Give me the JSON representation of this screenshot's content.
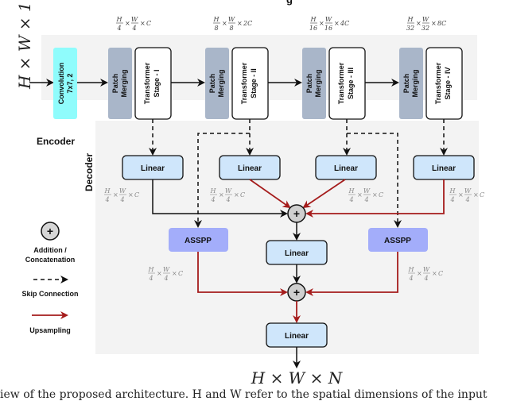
{
  "title_fragment": "g",
  "input_label": "H × W × 1",
  "output_label": "H × W × N",
  "encoder": {
    "label": "Encoder",
    "convolution": {
      "line1": "Convolution",
      "line2": "7x7, 2"
    },
    "stages": [
      {
        "merge": [
          "Patch",
          "Merging"
        ],
        "stage": [
          "Transformer",
          "Stage - I"
        ],
        "dims": {
          "h": "H",
          "hd": "4",
          "w": "W",
          "wd": "4",
          "c": "C"
        }
      },
      {
        "merge": [
          "Patch",
          "Merging"
        ],
        "stage": [
          "Transformer",
          "Stage - II"
        ],
        "dims": {
          "h": "H",
          "hd": "8",
          "w": "W",
          "wd": "8",
          "c": "2C"
        }
      },
      {
        "merge": [
          "Patch",
          "Merging"
        ],
        "stage": [
          "Transformer",
          "Stage - III"
        ],
        "dims": {
          "h": "H",
          "hd": "16",
          "w": "W",
          "wd": "16",
          "c": "4C"
        }
      },
      {
        "merge": [
          "Patch",
          "Merging"
        ],
        "stage": [
          "Transformer",
          "Stage - IV"
        ],
        "dims": {
          "h": "H",
          "hd": "32",
          "w": "W",
          "wd": "32",
          "c": "8C"
        }
      }
    ]
  },
  "decoder": {
    "label": "Decoder",
    "linear_label": "Linear",
    "asspp_label": "ASSPP",
    "dim": {
      "h": "H",
      "hd": "4",
      "w": "W",
      "wd": "4",
      "c": "C"
    },
    "plus": "+"
  },
  "legend": {
    "addition": [
      "Addition /",
      "Concatenation"
    ],
    "skip": "Skip Connection",
    "upsampling": "Upsampling"
  },
  "colors": {
    "conv": "#8ffcfc",
    "merge": "#a9b6c9",
    "linear": "#cfe6fb",
    "asspp": "#a3adfa",
    "upsample": "#a51c1c",
    "panel": "#f3f3f3",
    "plus_fill": "#cfcfcf"
  },
  "caption": "iew of the proposed architecture. H and W refer to the spatial dimensions of the input"
}
